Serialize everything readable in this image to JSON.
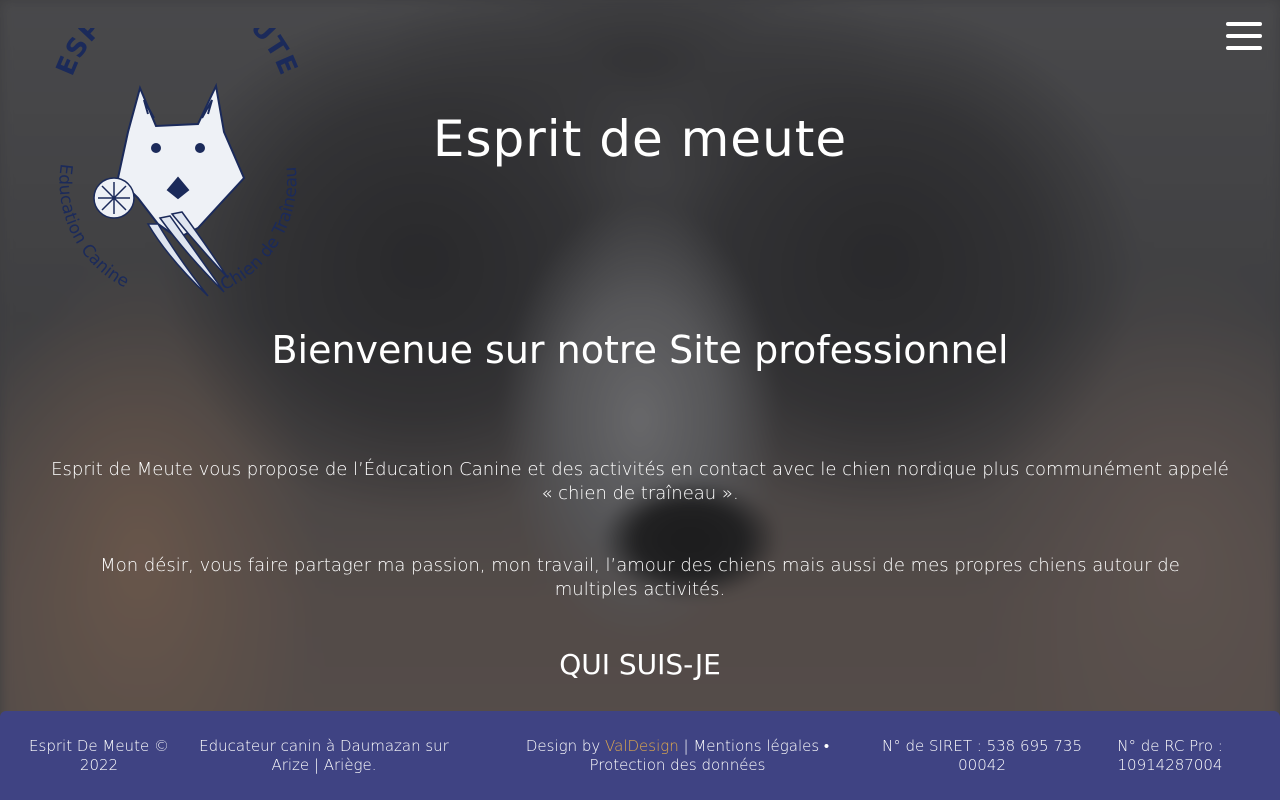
{
  "header": {
    "logo": {
      "top_text": "ESPRIT DE MEUTE",
      "left_text": "Education Canine",
      "right_text": "Chien de Traîneau"
    },
    "menu_icon": "hamburger-menu-icon"
  },
  "hero": {
    "title": "Esprit de meute",
    "welcome": "Bienvenue sur notre Site professionnel",
    "paragraph1": "Esprit de Meute vous propose de l’Éducation Canine et des activités en contact avec le chien nordique plus communément appelé « chien de traîneau ».",
    "paragraph2": "Mon désir, vous faire partager ma passion, mon travail, l’amour des chiens mais aussi de mes propres chiens autour de multiples activités.",
    "section_link": "QUI SUIS-JE"
  },
  "footer": {
    "copyright": "Esprit De Meute © 2022",
    "location": "Educateur canin à Daumazan sur Arize | Ariège.",
    "design_prefix": "Design by ",
    "design_link": "ValDesign",
    "sep1": " | ",
    "legal": "Mentions légales",
    "sep2": " • ",
    "privacy": "Protection des données",
    "siret": "N° de SIRET : 538 695 735 00042",
    "rc_pro": "N° de RC Pro : 10914287004"
  },
  "colors": {
    "footer_bg": "#3f4383",
    "accent_link": "#e0a94c",
    "logo_ink": "#1b2a5a"
  }
}
